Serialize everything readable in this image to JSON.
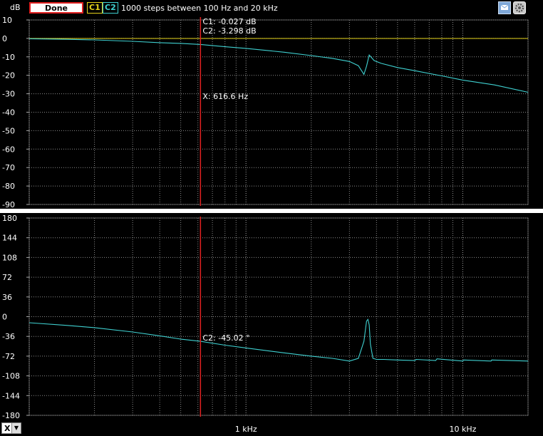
{
  "toolbar": {
    "status_text": "Done",
    "c1_label": "C1",
    "c2_label": "C2",
    "sweep_text": "1000 steps  between 100 Hz and 20 kHz",
    "icons": [
      "message-icon",
      "settings-icon"
    ]
  },
  "x_axis_selector": {
    "value": "X"
  },
  "cursor": {
    "x_label": "X: 616.6 Hz",
    "mag_c1": "C1: -0.027 dB",
    "mag_c2": "C2: -3.298 dB",
    "phase_c2": "C2: -45.02 °"
  },
  "colors": {
    "c1": "#e6d31a",
    "c2": "#3fd0d0",
    "cursor": "#e02020",
    "grid": "#8a8a8a"
  },
  "chart_data": [
    {
      "type": "line",
      "title": "",
      "ylabel": "dB",
      "xlabel": "",
      "xscale": "log",
      "xlim": [
        100,
        20000
      ],
      "ylim": [
        -90,
        10
      ],
      "yticks": [
        10,
        0,
        -10,
        -20,
        -30,
        -40,
        -50,
        -60,
        -70,
        -80,
        -90
      ],
      "grid": true,
      "series": [
        {
          "name": "C1",
          "x": [
            100,
            20000
          ],
          "y": [
            -0.03,
            -0.03
          ]
        },
        {
          "name": "C2",
          "x": [
            100,
            150,
            200,
            300,
            400,
            500,
            616.6,
            800,
            1000,
            1500,
            2000,
            2500,
            3000,
            3300,
            3500,
            3600,
            3700,
            3800,
            3900,
            4200,
            5000,
            6000,
            8000,
            10000,
            14000,
            20000
          ],
          "y": [
            -0.2,
            -0.5,
            -0.8,
            -1.6,
            -2.3,
            -2.7,
            -3.3,
            -4.5,
            -5.4,
            -7.5,
            -9.3,
            -10.8,
            -12.5,
            -14.8,
            -19.5,
            -15,
            -9.0,
            -10.5,
            -12.0,
            -13.5,
            -15.8,
            -17.5,
            -20.3,
            -22.6,
            -25.2,
            -29.2
          ]
        }
      ]
    },
    {
      "type": "line",
      "title": "",
      "ylabel": "",
      "xlabel": "",
      "xscale": "log",
      "xlim": [
        100,
        20000
      ],
      "ylim": [
        -180,
        180
      ],
      "yticks": [
        180,
        144,
        108,
        72,
        36,
        0,
        -36,
        -72,
        -108,
        -144,
        -180
      ],
      "xtick_labels": [
        {
          "x": 1000,
          "label": "1 kHz"
        },
        {
          "x": 10000,
          "label": "10 kHz"
        }
      ],
      "grid": true,
      "series": [
        {
          "name": "C2",
          "x": [
            100,
            150,
            200,
            300,
            400,
            500,
            616.6,
            800,
            1000,
            1500,
            2000,
            2500,
            3000,
            3300,
            3500,
            3600,
            3650,
            3700,
            3750,
            3850,
            4000,
            4300,
            5000,
            6000,
            6100,
            7500,
            7600,
            10000,
            10100,
            13500,
            13600,
            20000
          ],
          "y": [
            -11,
            -16,
            -20,
            -28,
            -35,
            -41,
            -45,
            -52,
            -57,
            -66,
            -72,
            -76,
            -81,
            -76,
            -45,
            -8,
            -5,
            -15,
            -50,
            -76,
            -78,
            -78,
            -79,
            -80,
            -78,
            -80,
            -77,
            -81,
            -79,
            -81,
            -79,
            -81
          ]
        }
      ]
    }
  ]
}
